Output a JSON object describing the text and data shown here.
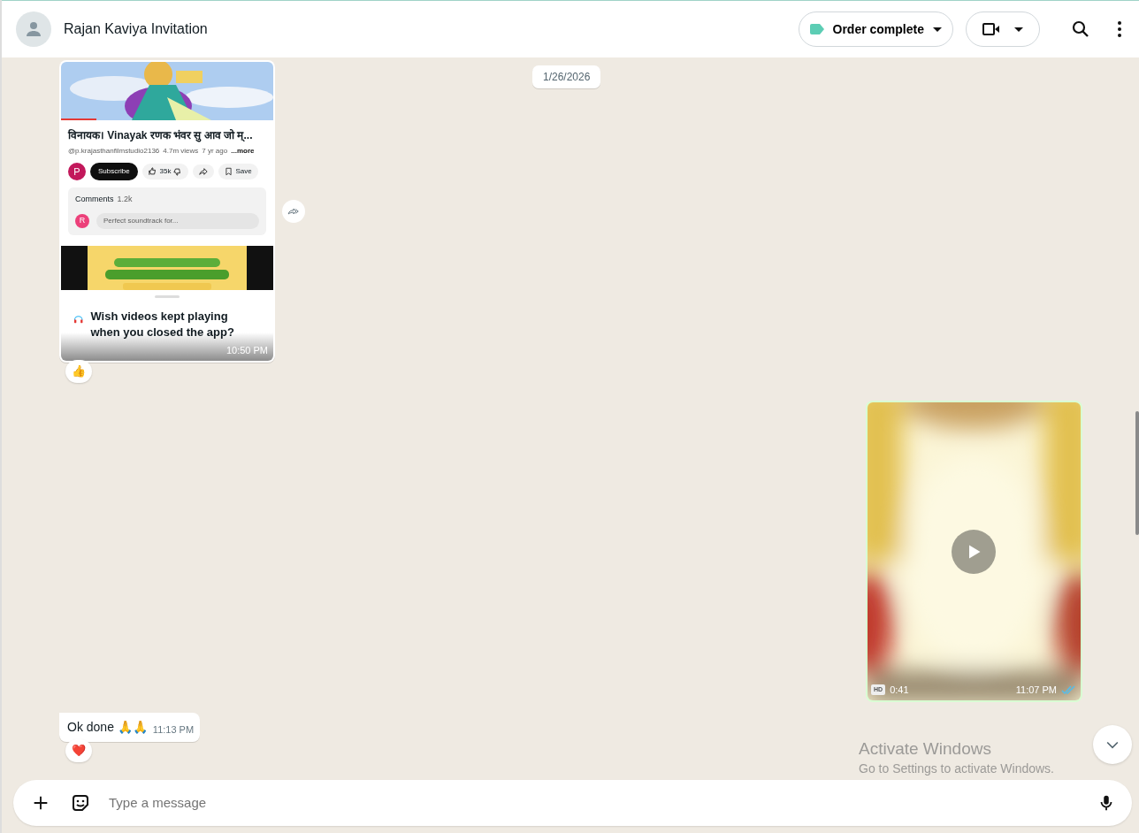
{
  "header": {
    "contact_name": "Rajan Kaviya Invitation",
    "label": {
      "text": "Order complete",
      "color": "#5ccdb4"
    }
  },
  "date_chip": "1/26/2026",
  "messages": [
    {
      "outgoing": false,
      "time": "10:50 PM",
      "reaction": "👍",
      "screenshot": {
        "title": "विनायक। Vinayak  रणक भंवर सु आव जो म्...",
        "channel": "@p.krajasthanfilmstudio2136",
        "views": "4.7m views",
        "age": "7 yr ago",
        "more": "...more",
        "avatar_letter": "P",
        "subscribe": "Subscribe",
        "likes": "35k",
        "save": "Save",
        "comments_label": "Comments",
        "comments_count": "1.2k",
        "commenter_letter": "R",
        "comment": "Perfect soundtrack for...",
        "promo": "Wish videos kept playing when you closed the app?"
      }
    },
    {
      "kind": "video",
      "outgoing": true,
      "hd": "HD",
      "duration": "0:41",
      "time": "11:07 PM",
      "read": true
    },
    {
      "kind": "text",
      "outgoing": false,
      "text": "Ok done 🙏🙏",
      "time": "11:13 PM",
      "reaction": "❤️"
    }
  ],
  "composer": {
    "placeholder": "Type a message"
  },
  "windows_notice": {
    "title": "Activate Windows",
    "subtitle": "Go to Settings to activate Windows."
  }
}
